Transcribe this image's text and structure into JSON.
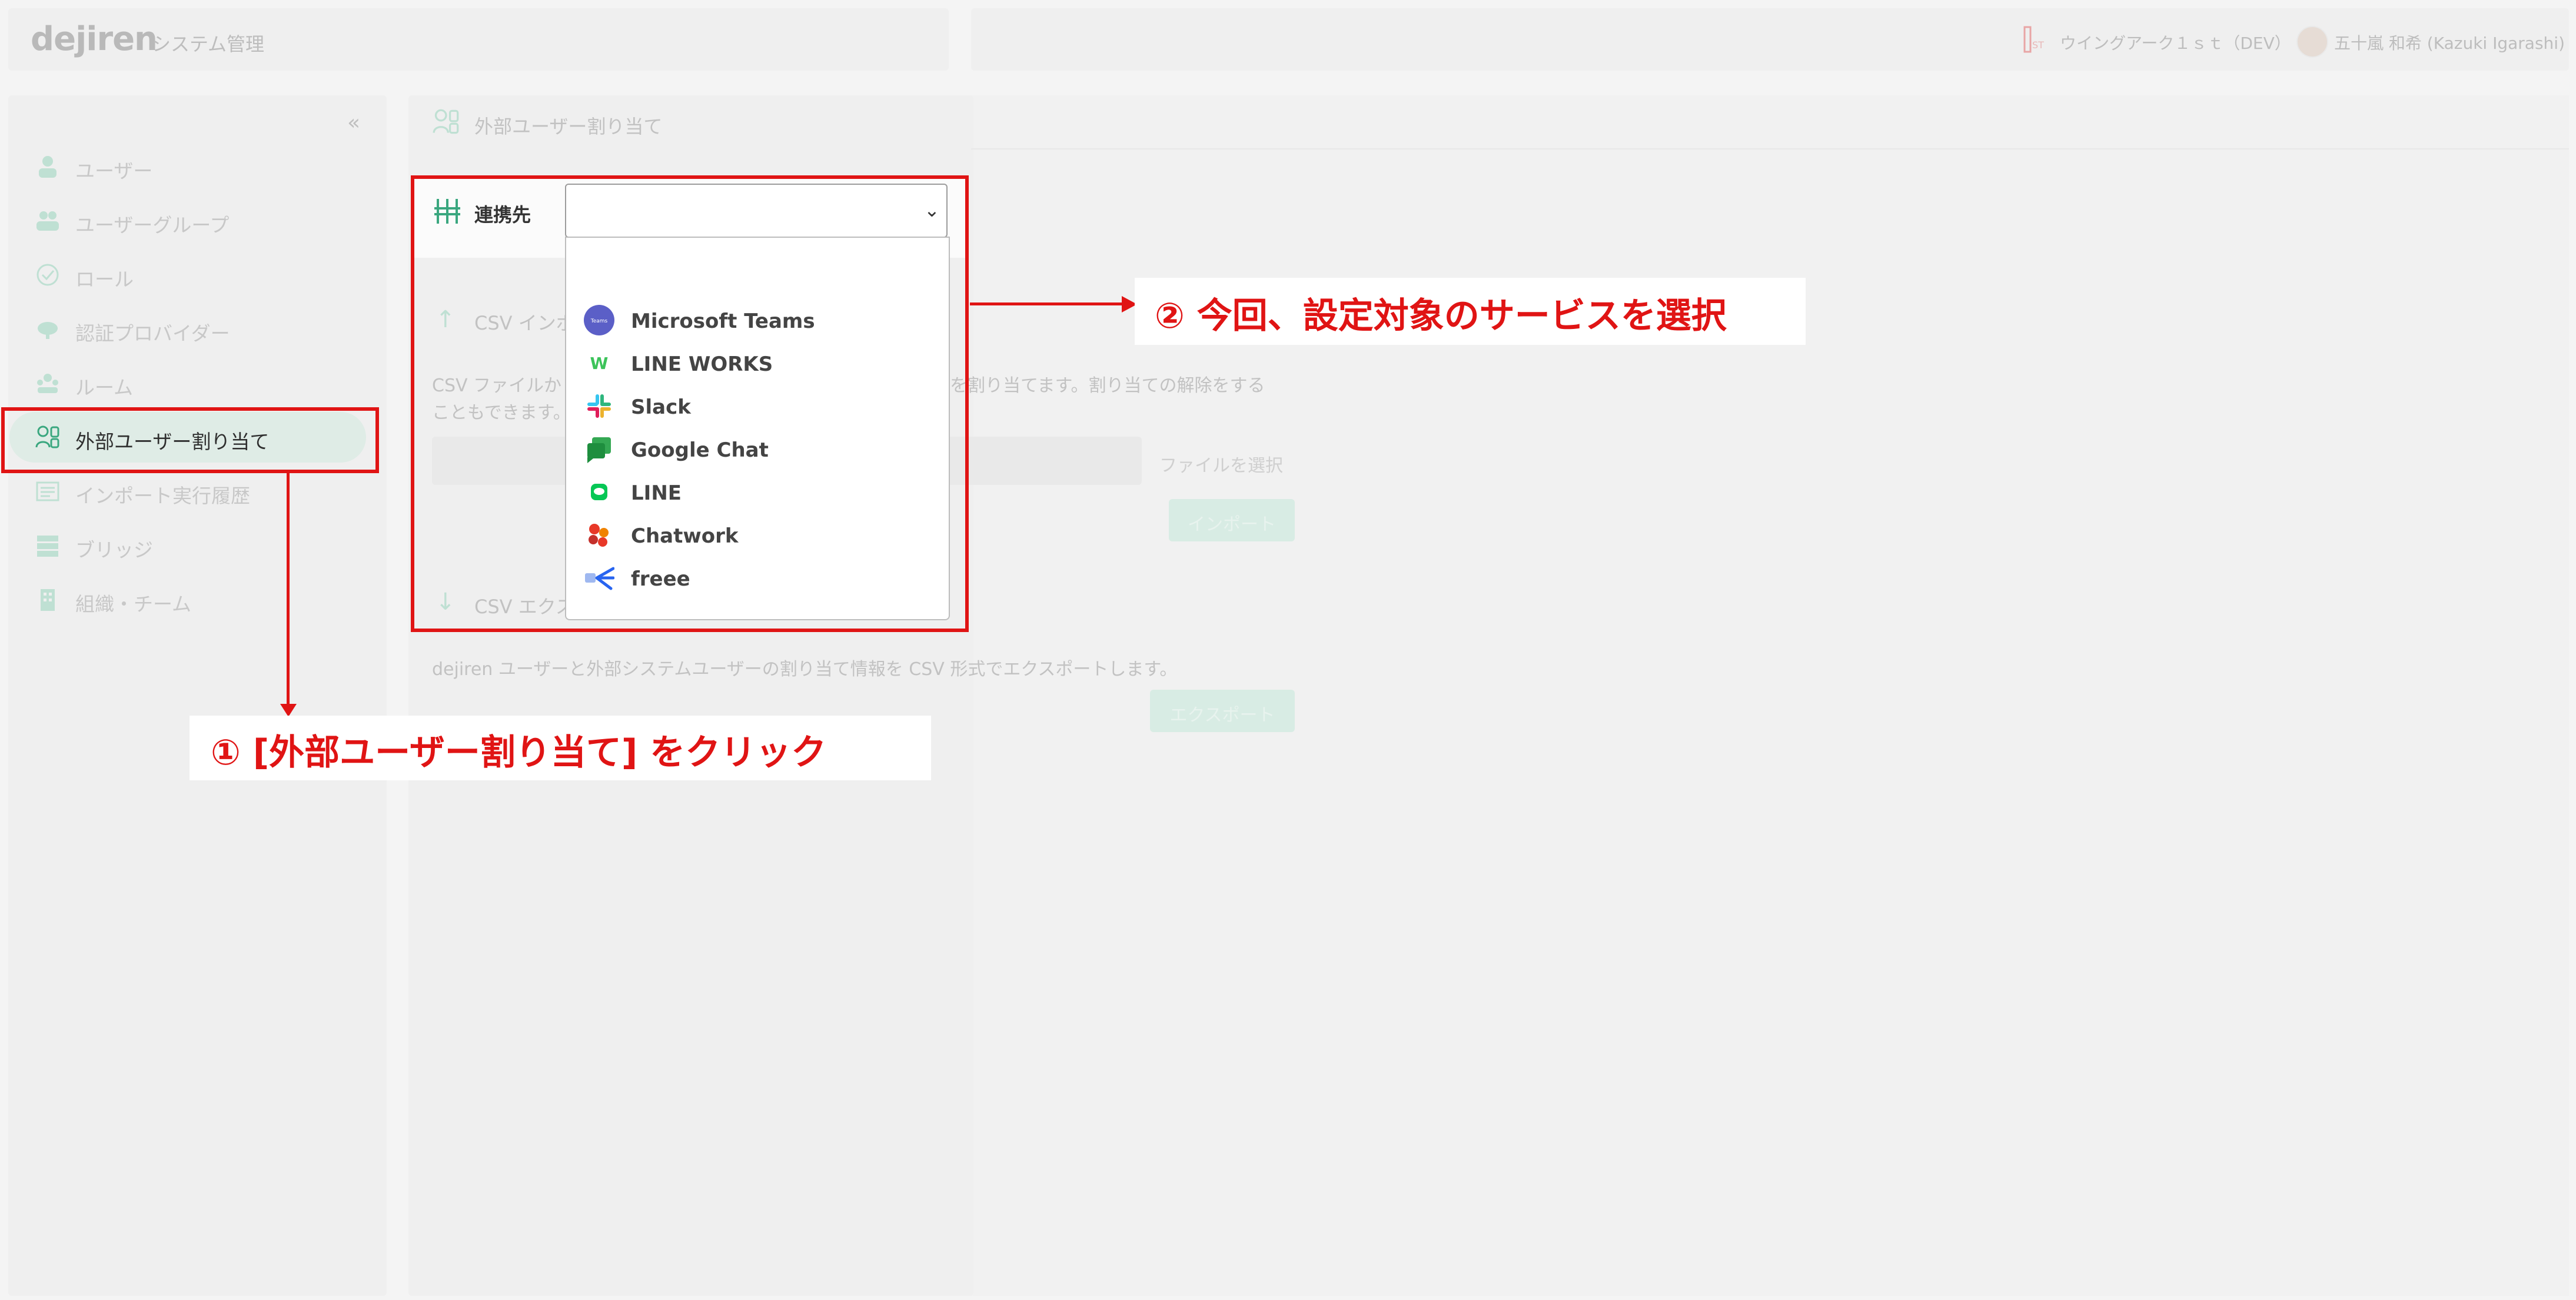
{
  "header": {
    "brand": "dejiren",
    "app_title": "システム管理",
    "org_name": "ウイングアーク１ｓｔ（DEV）",
    "user_name": "五十嵐 和希 (Kazuki Igarashi)"
  },
  "sidebar": {
    "collapse_icon": "«",
    "items": [
      {
        "label": "ユーザー",
        "icon": "user-icon"
      },
      {
        "label": "ユーザーグループ",
        "icon": "user-group-icon"
      },
      {
        "label": "ロール",
        "icon": "check-circle-icon"
      },
      {
        "label": "認証プロバイダー",
        "icon": "cloud-key-icon"
      },
      {
        "label": "ルーム",
        "icon": "room-icon"
      },
      {
        "label": "外部ユーザー割り当て",
        "icon": "external-user-icon",
        "active": true
      },
      {
        "label": "インポート実行履歴",
        "icon": "history-icon"
      },
      {
        "label": "ブリッジ",
        "icon": "bridge-icon"
      },
      {
        "label": "組織・チーム",
        "icon": "building-icon"
      }
    ]
  },
  "main": {
    "page_title": "外部ユーザー割り当て",
    "connection_label": "連携先",
    "select_value": "",
    "dropdown_options": [
      {
        "name": "Microsoft Teams",
        "logo": "teams-logo"
      },
      {
        "name": "LINE WORKS",
        "logo": "lineworks-logo"
      },
      {
        "name": "Slack",
        "logo": "slack-logo"
      },
      {
        "name": "Google Chat",
        "logo": "google-chat-logo"
      },
      {
        "name": "LINE",
        "logo": "line-logo"
      },
      {
        "name": "Chatwork",
        "logo": "chatwork-logo"
      },
      {
        "name": "freee",
        "logo": "freee-logo"
      }
    ],
    "csv_import": {
      "title": "CSV インポ",
      "desc_line1a": "CSV ファイルか",
      "desc_line1b": "を割り当てます。割り当ての解除をする",
      "desc_line2": "こともできます。",
      "file_select": "ファイルを選択",
      "import_button": "インポート"
    },
    "csv_export": {
      "title": "CSV エクス",
      "desc": "dejiren ユーザーと外部システムユーザーの割り当て情報を CSV 形式でエクスポートします。",
      "export_button": "エクスポート"
    }
  },
  "annotations": {
    "step1": "① [外部ユーザー割り当て] をクリック",
    "step2": "② 今回、設定対象のサービスを選択"
  },
  "colors": {
    "accent_green": "#3aa77f",
    "annotation_red": "#e01414",
    "active_nav_bg": "#dfece6"
  }
}
